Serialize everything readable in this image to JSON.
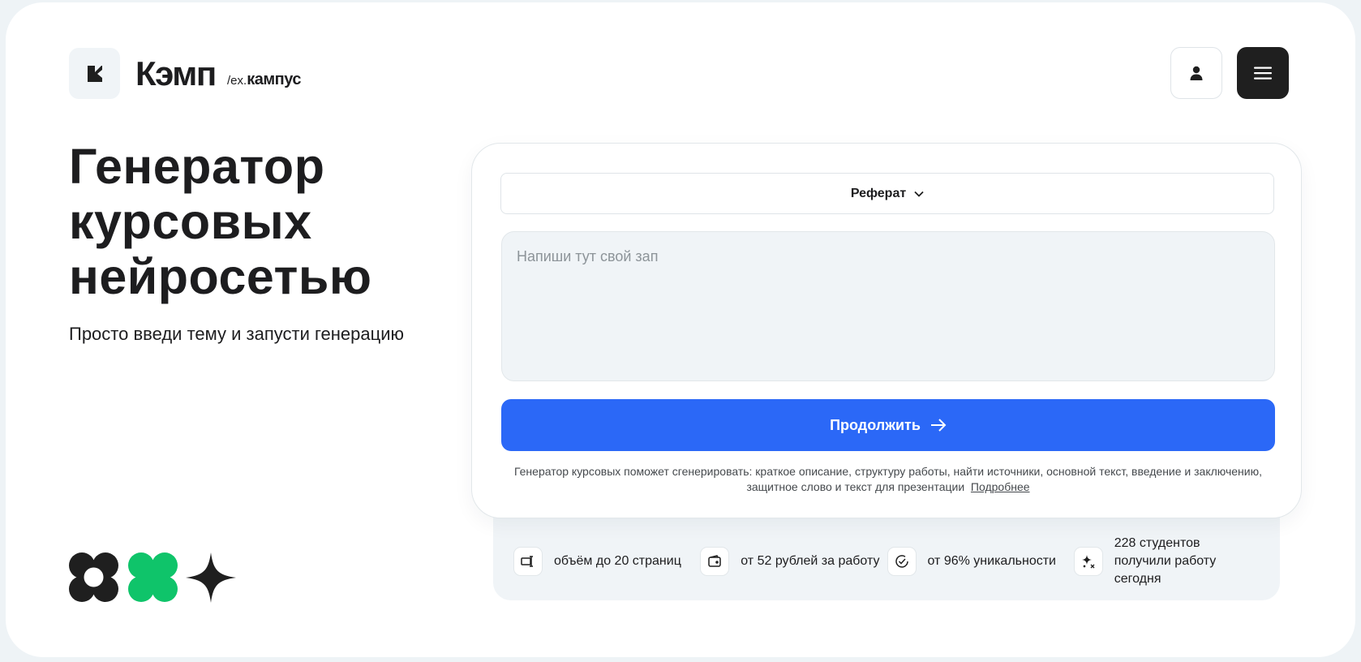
{
  "header": {
    "brand_name": "Кэмп",
    "brand_sub_prefix": "/ex.",
    "brand_sub_word": "кампус",
    "logo_icon": "k-logo-icon",
    "user_icon": "user-icon",
    "menu_icon": "hamburger-menu-icon"
  },
  "hero": {
    "title_line1": "Генератор",
    "title_line2": "курсовых",
    "title_line3": "нейросетью",
    "subtitle": "Просто введи тему и запусти генерацию"
  },
  "form": {
    "work_type": "Реферат",
    "topic_placeholder": "Напиши тут свой зап",
    "submit_label": "Продолжить",
    "note_line1": "Генератор курсовых поможет сгенерировать: краткое описание, структуру работы, найти источники, основной текст, введение и заключению,",
    "note_line2": "защитное слово и текст для презентации",
    "more_link": "Подробнее"
  },
  "features": [
    {
      "icon": "pages-icon",
      "text": "объём до 20 страниц"
    },
    {
      "icon": "wallet-icon",
      "text": "от 52 рублей за работу"
    },
    {
      "icon": "check-circle-icon",
      "text": "от 96% уникальности"
    },
    {
      "icon": "sparkle-icon",
      "text": "228 студентов получили работу сегодня"
    }
  ],
  "colors": {
    "accent": "#2b68f7",
    "green": "#0fc46a",
    "dark": "#1f1f1f"
  }
}
